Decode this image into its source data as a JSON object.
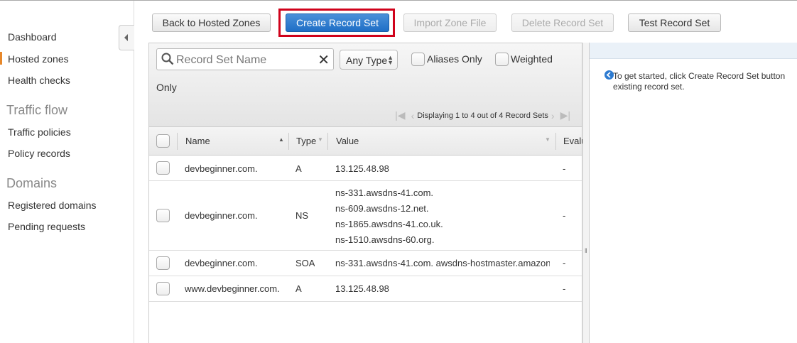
{
  "sidebar": {
    "items": [
      {
        "label": "Dashboard"
      },
      {
        "label": "Hosted zones",
        "active": true
      },
      {
        "label": "Health checks"
      }
    ],
    "sections": [
      {
        "title": "Traffic flow",
        "items": [
          {
            "label": "Traffic policies"
          },
          {
            "label": "Policy records"
          }
        ]
      },
      {
        "title": "Domains",
        "items": [
          {
            "label": "Registered domains"
          },
          {
            "label": "Pending requests"
          }
        ]
      }
    ],
    "active_color": "#e7882b"
  },
  "toolbar": {
    "back_label": "Back to Hosted Zones",
    "create_label": "Create Record Set",
    "import_label": "Import Zone File",
    "delete_label": "Delete Record Set",
    "test_label": "Test Record Set"
  },
  "filters": {
    "search_placeholder": "Record Set Name",
    "type_value": "Any Type",
    "aliases_label": "Aliases Only",
    "weighted_label": "Weighted",
    "weighted_cont": "Only"
  },
  "pager": {
    "text": "Displaying 1 to 4 out of 4 Record Sets"
  },
  "table": {
    "columns": {
      "name": "Name",
      "type": "Type",
      "value": "Value",
      "eval": "Evalu"
    },
    "rows": [
      {
        "name": "devbeginner.com.",
        "type": "A",
        "values": [
          "13.125.48.98"
        ],
        "eval": "-"
      },
      {
        "name": "devbeginner.com.",
        "type": "NS",
        "values": [
          "ns-331.awsdns-41.com.",
          "ns-609.awsdns-12.net.",
          "ns-1865.awsdns-41.co.uk.",
          "ns-1510.awsdns-60.org."
        ],
        "eval": "-"
      },
      {
        "name": "devbeginner.com.",
        "type": "SOA",
        "values": [
          "ns-331.awsdns-41.com. awsdns-hostmaster.amazon"
        ],
        "eval": "-"
      },
      {
        "name": "www.devbeginner.com.",
        "type": "A",
        "values": [
          "13.125.48.98"
        ],
        "eval": "-"
      }
    ]
  },
  "right_panel": {
    "info_line1": "To get started, click Create Record Set button",
    "info_line2": "existing record set."
  },
  "colors": {
    "primary": "#1f6fc6",
    "highlight": "#d0021b"
  }
}
